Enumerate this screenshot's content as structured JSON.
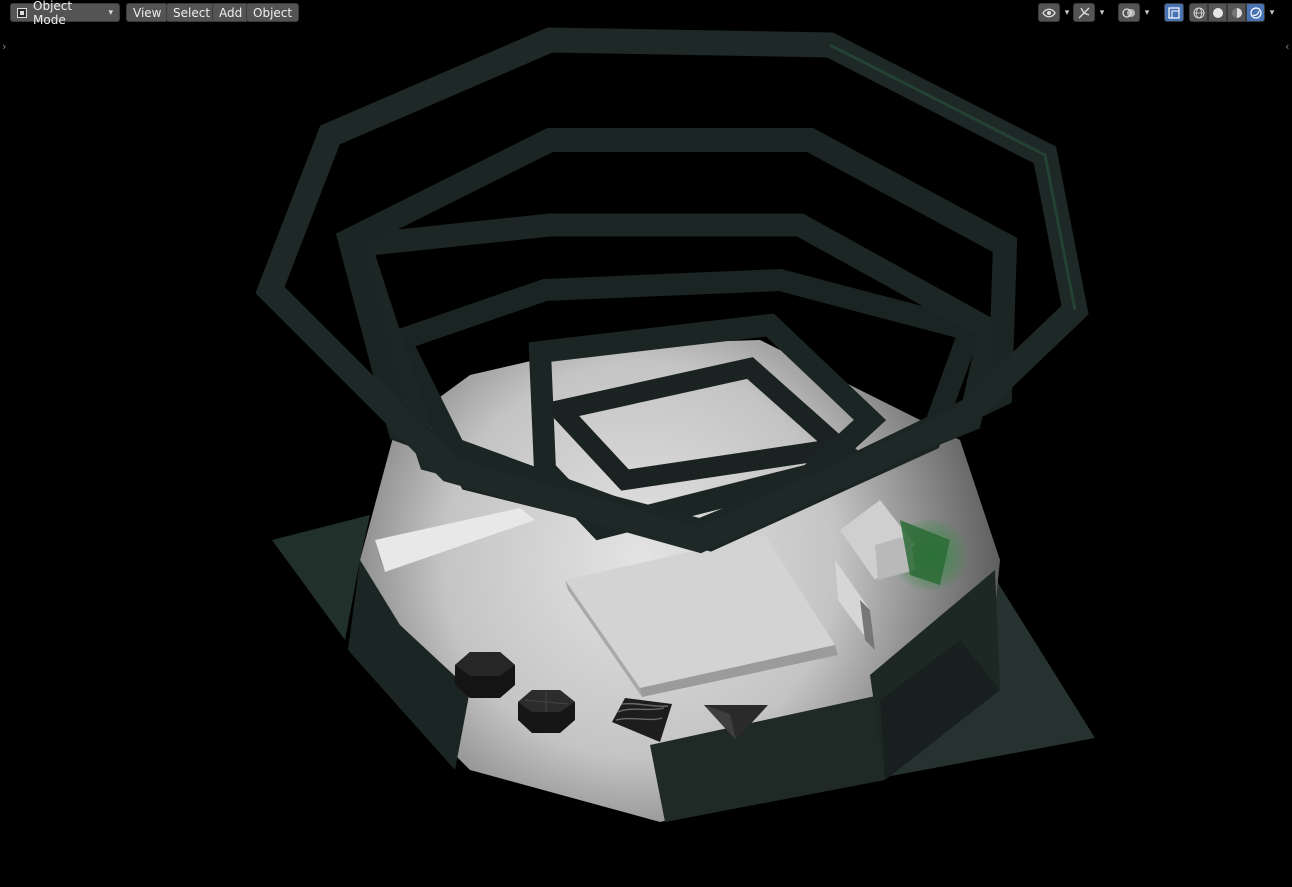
{
  "header": {
    "mode_label": "Object Mode",
    "menus": [
      "View",
      "Select",
      "Add",
      "Object"
    ]
  },
  "toolbar_right": {
    "icons": [
      "visibility-eye-icon",
      "gizmo-icon",
      "overlays-icon",
      "xray-icon",
      "wireframe-shading-icon",
      "solid-shading-icon",
      "material-shading-icon",
      "rendered-shading-icon"
    ],
    "active_shading": "rendered"
  },
  "colors": {
    "background": "#000000",
    "header_button": "#545454",
    "active_blue": "#4772b3",
    "frame_dark": "#1c2624",
    "floor_light": "#d8d8d8"
  }
}
